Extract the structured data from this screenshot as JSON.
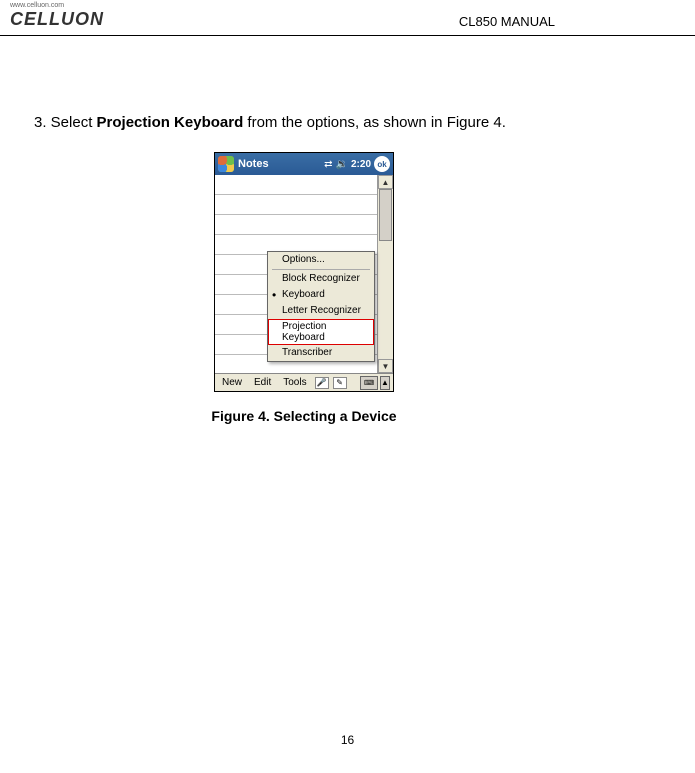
{
  "header": {
    "logo_url": "www.celluon.com",
    "logo_text": "CELLUON",
    "doc_title": "CL850 MANUAL"
  },
  "content": {
    "step_num": "3. Select ",
    "step_bold": "Projection Keyboard",
    "step_rest": " from the options, as shown in Figure 4.",
    "caption": "Figure 4. Selecting a Device"
  },
  "screenshot": {
    "titlebar": {
      "app_title": "Notes",
      "time": "2:20",
      "ok": "ok"
    },
    "menu": {
      "options": "Options...",
      "block_recognizer": "Block Recognizer",
      "keyboard": "Keyboard",
      "letter_recognizer": "Letter Recognizer",
      "projection_keyboard": "Projection Keyboard",
      "transcriber": "Transcriber"
    },
    "bottombar": {
      "new": "New",
      "edit": "Edit",
      "tools": "Tools"
    },
    "scrollbar": {
      "up": "▲",
      "down": "▼"
    }
  },
  "page_number": "16"
}
